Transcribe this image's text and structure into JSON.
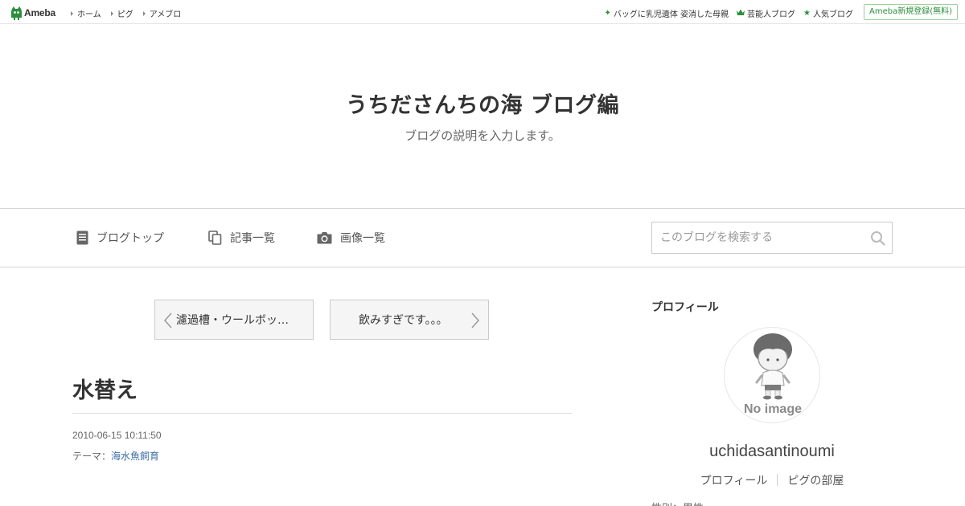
{
  "header": {
    "logo_text": "Ameba",
    "nav": [
      {
        "label": "ホーム"
      },
      {
        "label": "ピグ"
      },
      {
        "label": "アメブロ"
      }
    ],
    "right_links": [
      {
        "icon": "sparkle-icon",
        "label": "バッグに乳児遺体 姿消した母親"
      },
      {
        "icon": "crown-icon",
        "label": "芸能人ブログ"
      },
      {
        "icon": "star-icon",
        "label": "人気ブログ"
      }
    ],
    "register_label": "Ameba新規登録(無料)",
    "accent_color": "#2b8e3d"
  },
  "blog": {
    "title": "うちださんちの海 ブログ編",
    "description": "ブログの説明を入力します。"
  },
  "blog_nav": {
    "items": [
      {
        "icon": "document-icon",
        "label": "ブログトップ"
      },
      {
        "icon": "copy-icon",
        "label": "記事一覧"
      },
      {
        "icon": "camera-icon",
        "label": "画像一覧"
      }
    ],
    "search_placeholder": "このブログを検索する"
  },
  "pager": {
    "prev_label": "濾過槽・ウールボッ…",
    "next_label": "飲みすぎです。。。"
  },
  "article": {
    "title": "水替え",
    "datetime": "2010-06-15 10:11:50",
    "theme_prefix": "テーマ：",
    "theme": "海水魚飼育"
  },
  "profile": {
    "heading": "プロフィール",
    "avatar_text": "No image",
    "name": "uchidasantinoumi",
    "links": [
      {
        "label": "プロフィール"
      },
      {
        "label": "ピグの部屋"
      }
    ],
    "partial_text": "性別：男性"
  }
}
